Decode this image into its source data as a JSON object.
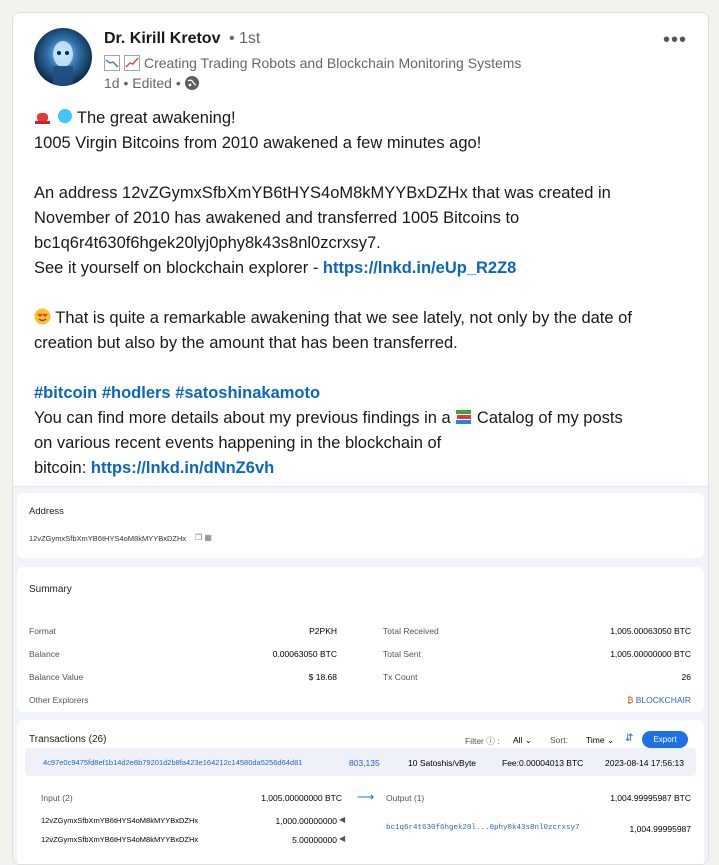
{
  "author": {
    "name": "Dr. Kirill Kretov",
    "degree": "• 1st",
    "headline": "Creating Trading Robots and Blockchain Monitoring Systems",
    "meta": "1d • Edited •"
  },
  "post": {
    "l1": "The great awakening!",
    "l2": "1005 Virgin Bitcoins from 2010 awakened a few minutes ago!",
    "l3": "An address 12vZGymxSfbXmYB6tHYS4oM8kMYYBxDZHx that was created in",
    "l4": "November of 2010 has awakened and transferred 1005 Bitcoins to",
    "l5": "bc1q6r4t630f6hgek20lyj0phy8k43s8nl0zcrxsy7.",
    "l6": "See it yourself on blockchain explorer - ",
    "link1": "https://lnkd.in/eUp_R2Z8",
    "l7": "That is quite a remarkable awakening that we see lately, not only by the date of",
    "l8": "creation but also by the amount that has been transferred.",
    "hashtags": "#bitcoin #hodlers #satoshinakamoto",
    "l9a": "You can find more details about my previous findings in a ",
    "l9b": " Catalog of my posts",
    "l10": "on various recent events happening in the blockchain of",
    "l11": "bitcoin: ",
    "link2": "https://lnkd.in/dNnZ6vh"
  },
  "explorer": {
    "address_label": "Address",
    "address": "12vZGymxSfbXmYB6tHYS4oM8kMYYBxDZHx",
    "summary_title": "Summary",
    "left": [
      {
        "label": "Format",
        "value": "P2PKH"
      },
      {
        "label": "Balance",
        "value": "0.00063050 BTC"
      },
      {
        "label": "Balance Value",
        "value": "$ 18.68"
      },
      {
        "label": "Other Explorers",
        "value": ""
      }
    ],
    "right": [
      {
        "label": "Total Received",
        "value": "1,005.00063050 BTC"
      },
      {
        "label": "Total Sent",
        "value": "1,005.00000000 BTC"
      },
      {
        "label": "Tx Count",
        "value": "26"
      },
      {
        "label": "",
        "value": "BLOCKCHAIR"
      }
    ],
    "tx_title": "Transactions (26)",
    "filter_label": "Filter",
    "filter_value": "All",
    "sort_label": "Sort:",
    "sort_value": "Time",
    "export": "Export",
    "tx": {
      "hash": "4c97e0c9475fd8ef1b14d2e8b79201d2b8fa423e164212c14580da5256d64d81",
      "block": "803,135",
      "fee_rate": "10 Satoshis/vByte",
      "fee": "Fee:0.00004013 BTC",
      "time": "2023-08-14 17:56:13",
      "input_label": "Input (2)",
      "input_total": "1,005.00000000 BTC",
      "output_label": "Output (1)",
      "output_total": "1,004.99995987 BTC",
      "inputs": [
        {
          "addr": "12vZGymxSfbXmYB6tHYS4oM8kMYYBxDZHx",
          "amount": "1,000.00000000"
        },
        {
          "addr": "12vZGymxSfbXmYB6tHYS4oM8kMYYBxDZHx",
          "amount": "5.00000000"
        }
      ],
      "output_addr": "bc1q6r4t630f6hgek20l...0phy8k43s8nl0zcrxsy7",
      "output_amount": "1,004.99995987"
    }
  }
}
